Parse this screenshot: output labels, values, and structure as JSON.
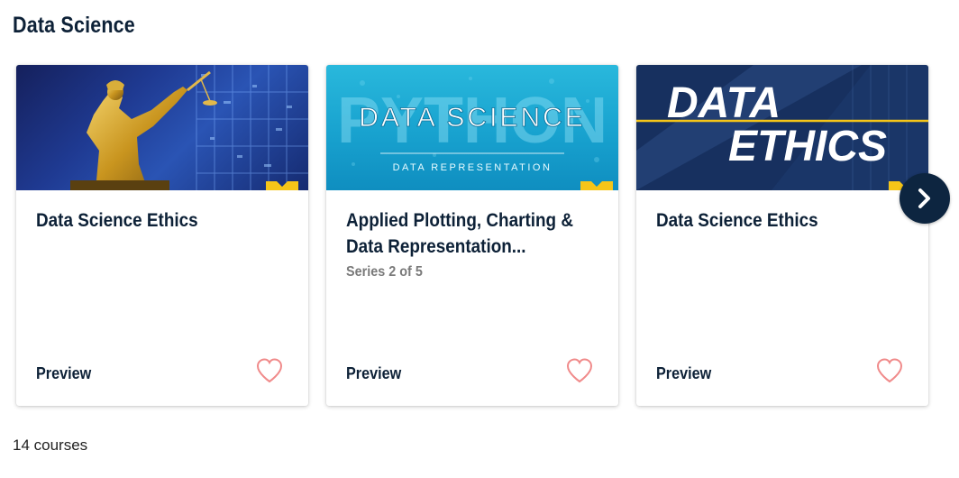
{
  "section": {
    "title": "Data Science"
  },
  "cards": [
    {
      "title": "Data Science Ethics",
      "series": "",
      "preview_label": "Preview",
      "thumbnail": {
        "theme": "lady-justice-statue",
        "colors": [
          "#1f3a92",
          "#c9a227"
        ]
      }
    },
    {
      "title": "Applied Plotting, Charting & Data Representation...",
      "series": "Series 2 of 5",
      "preview_label": "Preview",
      "thumbnail": {
        "theme": "python-data-science",
        "text_big": "DATA SCIENCE",
        "text_bg": "PYTHON",
        "text_small": "DATA REPRESENTATION",
        "colors": [
          "#29b8dc",
          "#ffffff"
        ]
      }
    },
    {
      "title": "Data Science Ethics",
      "series": "",
      "preview_label": "Preview",
      "thumbnail": {
        "theme": "data-ethics",
        "line1": "DATA",
        "line2": "ETHICS",
        "colors": [
          "#17305f",
          "#f5c518"
        ]
      }
    }
  ],
  "navigation": {
    "next_icon": "chevron-right-icon"
  },
  "footer": {
    "count": "14 courses"
  },
  "colors": {
    "heading": "#0d2137",
    "heart": "#f08a8a",
    "accent_yellow": "#f5c518",
    "nav_button": "#0d2540"
  }
}
